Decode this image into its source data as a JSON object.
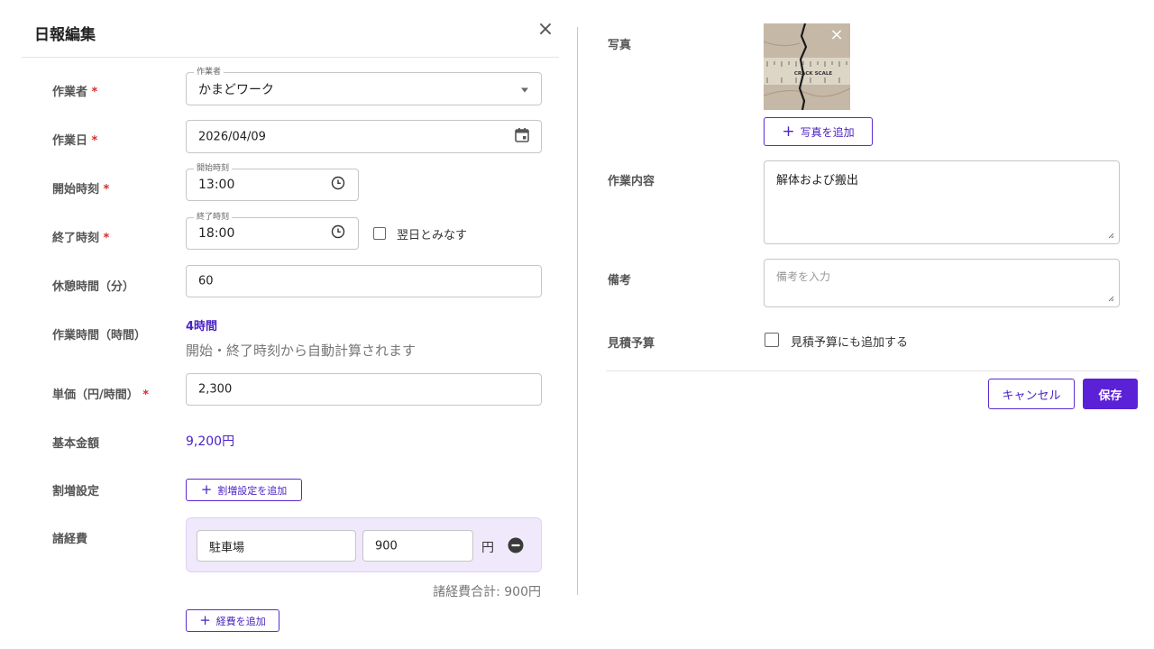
{
  "dialog": {
    "title": "日報編集",
    "close_label": "×"
  },
  "labels": {
    "worker": "作業者",
    "work_date": "作業日",
    "start_time": "開始時刻",
    "end_time": "終了時刻",
    "break": "休憩時間（分）",
    "work_hours": "作業時間（時間）",
    "unit_price": "単価（円/時間）",
    "base_amount": "基本金額",
    "surcharge": "割増設定",
    "expenses": "諸経費",
    "photo": "写真",
    "work_content": "作業内容",
    "notes": "備考",
    "estimate": "見積予算"
  },
  "required_mark": "*",
  "worker": {
    "float_label": "作業者",
    "value": "かまどワーク"
  },
  "work_date": {
    "value": "2026/04/09"
  },
  "start_time": {
    "float_label": "開始時刻",
    "value": "13:00"
  },
  "end_time": {
    "float_label": "終了時刻",
    "value": "18:00",
    "next_day_label": "翌日とみなす"
  },
  "break_minutes": {
    "value": "60"
  },
  "work_hours": {
    "value": "4時間",
    "hint": "開始・終了時刻から自動計算されます"
  },
  "unit_price": {
    "value": "2,300"
  },
  "base_amount": {
    "value": "9,200円"
  },
  "surcharge": {
    "add_label": "割増設定を追加"
  },
  "expenses": {
    "items": [
      {
        "name": "駐車場",
        "amount": "900",
        "unit": "円"
      }
    ],
    "total_label": "諸経費合計: 900円",
    "add_label": "経費を追加"
  },
  "photo": {
    "add_label": "写真を追加",
    "scale_text": "CRACK SCALE"
  },
  "work_content": {
    "value": "解体および搬出"
  },
  "notes": {
    "placeholder": "備考を入力"
  },
  "estimate": {
    "checkbox_label": "見積予算にも追加する"
  },
  "footer": {
    "cancel_label": "キャンセル",
    "save_label": "保存"
  },
  "colors": {
    "accent": "#5b21d6",
    "expense_bg": "#efe9fb",
    "required": "#d32f2f"
  }
}
